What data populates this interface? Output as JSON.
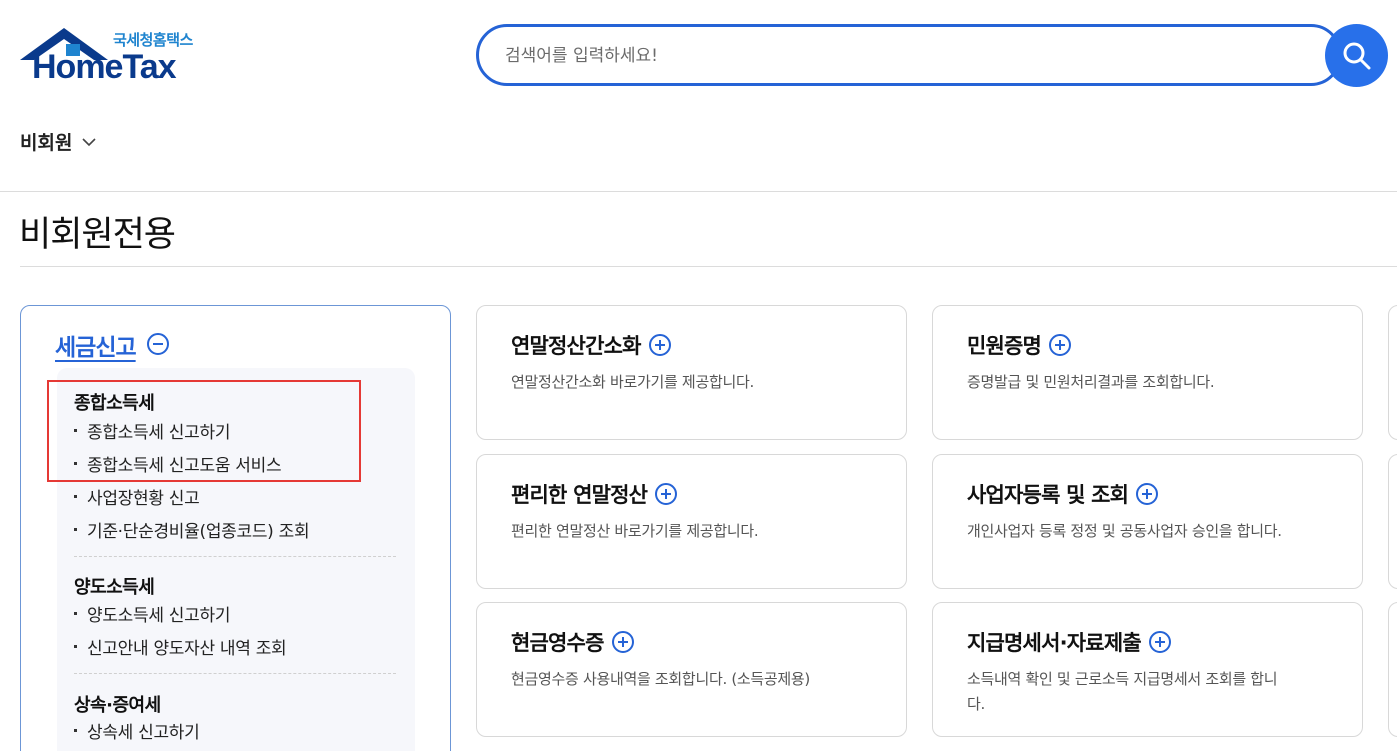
{
  "header": {
    "logo_sub": "국세청홈택스",
    "logo_main": "HomeTax",
    "search_placeholder": "검색어를 입력하세요!",
    "member_label": "비회원"
  },
  "page": {
    "title": "비회원전용"
  },
  "tax_filing": {
    "title": "세금신고",
    "groups": [
      {
        "title": "종합소득세",
        "items": [
          "종합소득세 신고하기",
          "종합소득세 신고도움 서비스",
          "사업장현황 신고",
          "기준·단순경비율(업종코드) 조회"
        ]
      },
      {
        "title": "양도소득세",
        "items": [
          "양도소득세 신고하기",
          "신고안내 양도자산 내역 조회"
        ]
      },
      {
        "title": "상속·증여세",
        "items": [
          "상속세 신고하기"
        ]
      }
    ]
  },
  "cards": [
    {
      "title": "연말정산간소화",
      "desc": "연말정산간소화 바로가기를 제공합니다."
    },
    {
      "title": "민원증명",
      "desc": "증명발급 및 민원처리결과를 조회합니다."
    },
    {
      "title": "편리한 연말정산",
      "desc": "편리한 연말정산 바로가기를 제공합니다."
    },
    {
      "title": "사업자등록 및 조회",
      "desc": "개인사업자 등록 정정 및 공동사업자 승인을 합니다."
    },
    {
      "title": "현금영수증",
      "desc": "현금영수증 사용내역을 조회합니다. (소득공제용)"
    },
    {
      "title": "지급명세서·자료제출",
      "desc": "소득내역 확인 및 근로소득 지급명세서 조회를 합니다."
    }
  ],
  "colors": {
    "accent": "#2563d6",
    "highlight": "#e53935",
    "logo_dark": "#0a3a8c"
  }
}
